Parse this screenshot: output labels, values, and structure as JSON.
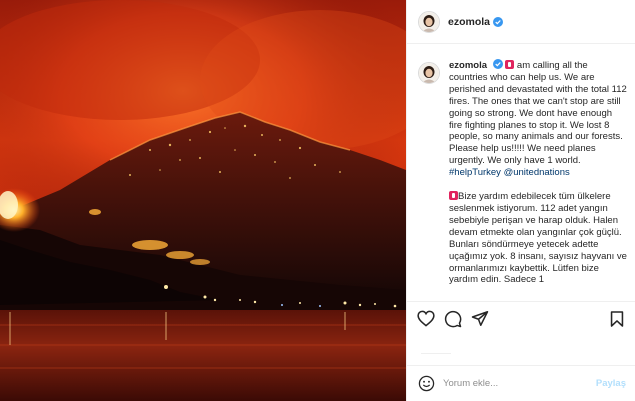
{
  "post": {
    "username": "ezomola",
    "caption_username": "ezomola",
    "caption_en_text": " am calling all the countries who can help us. We are perished and devastated with the total 112 fires. The ones that we can't stop are still going so strong. We dont have enough fire fighting planes to stop it. We lost 8 people, so many animals and our forests. Please help us!!!!! We need planes urgently. We only have 1 world.",
    "hashtags": [
      "#helpTurkey",
      "@unitednations"
    ],
    "caption_tr_text": "Bize yardım edebilecek tüm ülkelere seslenmek istiyorum. 112 adet yangın sebebiyle perişan ve harap olduk. Halen devam etmekte olan yangınlar çok güçlü. Bunları söndürmeye yetecek adette uçağımız yok. 8 insanı, sayısız hayvanı ve ormanlarımızı kaybettik. Lütfen bize yardım edin. Sadece 1",
    "image_subject": "forest fire on mountains at night reflected on water"
  },
  "comment": {
    "placeholder": "Yorum ekle...",
    "share_label": "Paylaş"
  },
  "colors": {
    "verified": "#3897f0",
    "link": "#00376b",
    "share_disabled": "#b2dffc"
  },
  "icons": [
    "verified-badge-icon",
    "alert-emoji-icon",
    "heart-icon",
    "comment-icon",
    "share-icon",
    "bookmark-icon",
    "emoji-icon"
  ]
}
